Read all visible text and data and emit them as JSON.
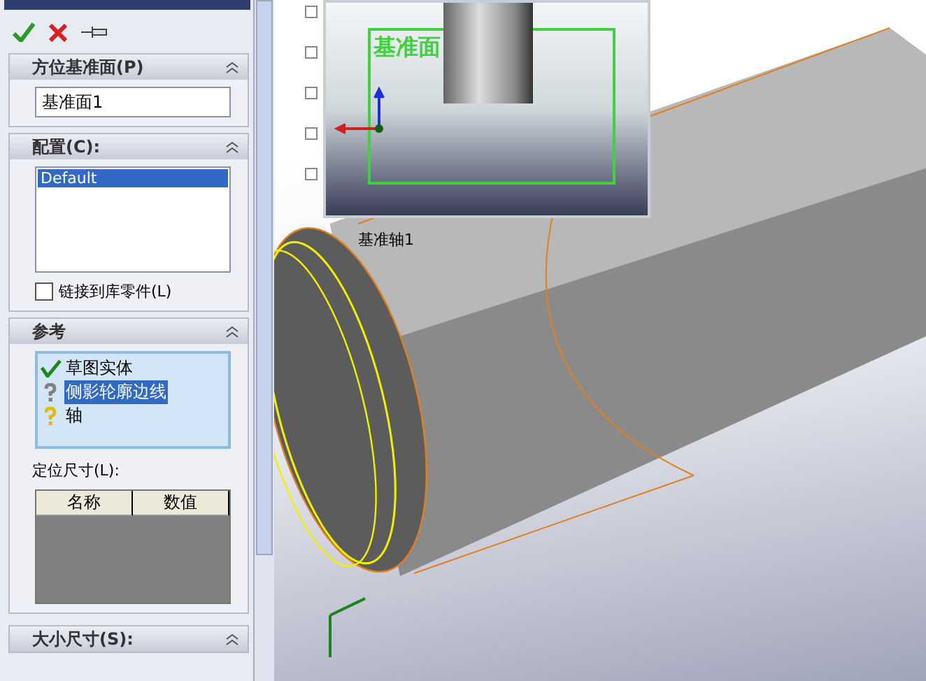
{
  "sections": [
    {
      "kind": "field",
      "title": "方位基准面(P)",
      "value": "基准面1"
    },
    {
      "kind": "list",
      "title": "配置(C):",
      "items": [
        {
          "label": "Default",
          "selected": true
        }
      ],
      "checkbox": {
        "label": "链接到库零件(L)",
        "checked": false
      }
    },
    {
      "kind": "refs",
      "title": "参考",
      "refs": [
        {
          "label": "草图实体",
          "kind": "resolved",
          "selected": false
        },
        {
          "label": "侧影轮廓边线",
          "kind": "ambiguous",
          "selected": true
        },
        {
          "label": "轴",
          "kind": "pending",
          "selected": false
        }
      ],
      "table_label": "定位尺寸(L):",
      "columns": [
        "名称",
        "数值"
      ]
    },
    {
      "kind": "header",
      "title": "大小尺寸(S):"
    }
  ],
  "viewport": {
    "plane_label": "基准面",
    "tree": [
      "基准轴1"
    ]
  }
}
